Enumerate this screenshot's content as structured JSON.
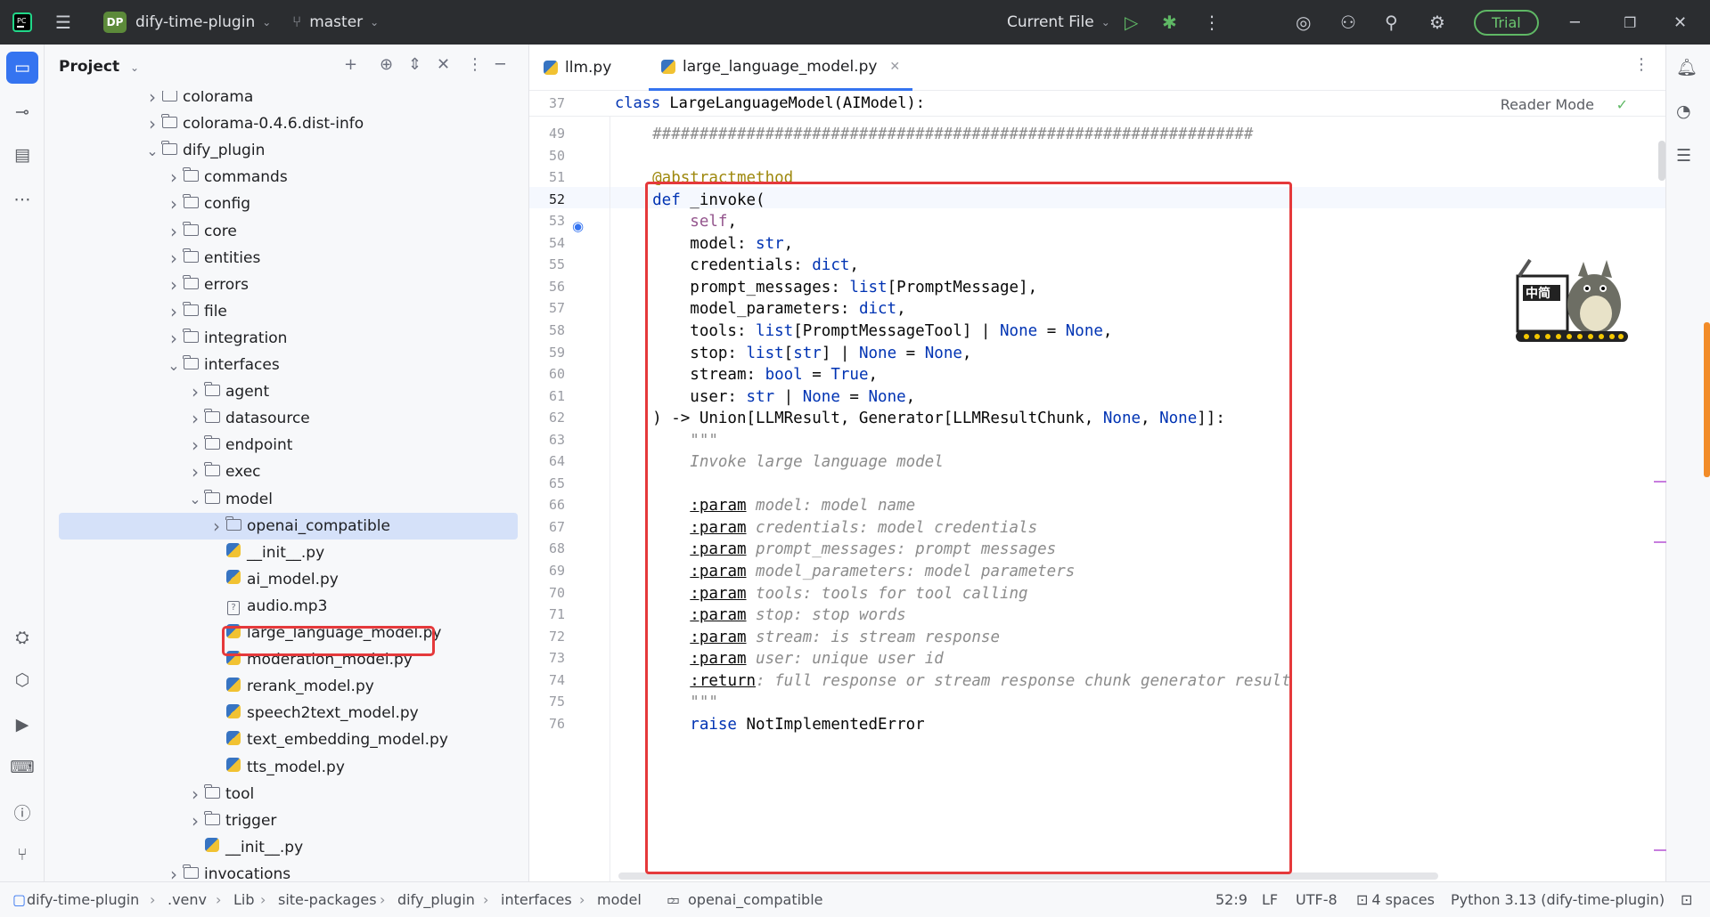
{
  "titlebar": {
    "project_badge": "DP",
    "project_name": "dify-time-plugin",
    "branch": "master",
    "run_config": "Current File",
    "trial": "Trial"
  },
  "project_panel": {
    "title": "Project"
  },
  "tree": [
    {
      "label": "colorama",
      "type": "folder",
      "depth": 0,
      "arrow": "right"
    },
    {
      "label": "colorama-0.4.6.dist-info",
      "type": "folder",
      "depth": 0,
      "arrow": "right"
    },
    {
      "label": "dify_plugin",
      "type": "folder",
      "depth": 0,
      "arrow": "down"
    },
    {
      "label": "commands",
      "type": "folder",
      "depth": 1,
      "arrow": "right"
    },
    {
      "label": "config",
      "type": "folder",
      "depth": 1,
      "arrow": "right"
    },
    {
      "label": "core",
      "type": "folder",
      "depth": 1,
      "arrow": "right"
    },
    {
      "label": "entities",
      "type": "folder",
      "depth": 1,
      "arrow": "right"
    },
    {
      "label": "errors",
      "type": "folder",
      "depth": 1,
      "arrow": "right"
    },
    {
      "label": "file",
      "type": "folder",
      "depth": 1,
      "arrow": "right"
    },
    {
      "label": "integration",
      "type": "folder",
      "depth": 1,
      "arrow": "right"
    },
    {
      "label": "interfaces",
      "type": "folder",
      "depth": 1,
      "arrow": "down"
    },
    {
      "label": "agent",
      "type": "folder",
      "depth": 2,
      "arrow": "right"
    },
    {
      "label": "datasource",
      "type": "folder",
      "depth": 2,
      "arrow": "right"
    },
    {
      "label": "endpoint",
      "type": "folder",
      "depth": 2,
      "arrow": "right"
    },
    {
      "label": "exec",
      "type": "folder",
      "depth": 2,
      "arrow": "right"
    },
    {
      "label": "model",
      "type": "folder",
      "depth": 2,
      "arrow": "down"
    },
    {
      "label": "openai_compatible",
      "type": "folder",
      "depth": 3,
      "arrow": "right",
      "selected": true
    },
    {
      "label": "__init__.py",
      "type": "py",
      "depth": 3,
      "arrow": ""
    },
    {
      "label": "ai_model.py",
      "type": "py",
      "depth": 3,
      "arrow": ""
    },
    {
      "label": "audio.mp3",
      "type": "unknown",
      "depth": 3,
      "arrow": ""
    },
    {
      "label": "large_language_model.py",
      "type": "py",
      "depth": 3,
      "arrow": ""
    },
    {
      "label": "moderation_model.py",
      "type": "py",
      "depth": 3,
      "arrow": ""
    },
    {
      "label": "rerank_model.py",
      "type": "py",
      "depth": 3,
      "arrow": ""
    },
    {
      "label": "speech2text_model.py",
      "type": "py",
      "depth": 3,
      "arrow": ""
    },
    {
      "label": "text_embedding_model.py",
      "type": "py",
      "depth": 3,
      "arrow": ""
    },
    {
      "label": "tts_model.py",
      "type": "py",
      "depth": 3,
      "arrow": ""
    },
    {
      "label": "tool",
      "type": "folder",
      "depth": 2,
      "arrow": "right"
    },
    {
      "label": "trigger",
      "type": "folder",
      "depth": 2,
      "arrow": "right"
    },
    {
      "label": "__init__.py",
      "type": "py",
      "depth": 2,
      "arrow": ""
    },
    {
      "label": "invocations",
      "type": "folder",
      "depth": 1,
      "arrow": "right"
    }
  ],
  "editor": {
    "tabs": [
      {
        "label": "llm.py",
        "active": false
      },
      {
        "label": "large_language_model.py",
        "active": true
      }
    ],
    "reader_mode": "Reader Mode",
    "sticky_line_number": "37",
    "sticky_code": [
      [
        "kw",
        "class"
      ],
      [
        "",
        " LargeLanguageModel(AIModel):"
      ]
    ],
    "lines": [
      {
        "n": "49",
        "tokens": [
          [
            "cmt",
            "    ################################################################"
          ]
        ]
      },
      {
        "n": "50",
        "tokens": []
      },
      {
        "n": "51",
        "tokens": [
          [
            "dec",
            "    @abstractmethod"
          ]
        ]
      },
      {
        "n": "52",
        "tokens": [
          [
            "kw",
            "    def"
          ],
          [
            "",
            " _invoke("
          ]
        ]
      },
      {
        "n": "53",
        "tokens": [
          [
            "sf",
            "        self"
          ],
          [
            "",
            ","
          ]
        ]
      },
      {
        "n": "54",
        "tokens": [
          [
            "",
            "        model: "
          ],
          [
            "kw",
            "str"
          ],
          [
            "",
            ","
          ]
        ]
      },
      {
        "n": "55",
        "tokens": [
          [
            "",
            "        credentials: "
          ],
          [
            "kw",
            "dict"
          ],
          [
            "",
            ","
          ]
        ]
      },
      {
        "n": "56",
        "tokens": [
          [
            "",
            "        prompt_messages: "
          ],
          [
            "kw",
            "list"
          ],
          [
            "",
            "[PromptMessage],"
          ]
        ]
      },
      {
        "n": "57",
        "tokens": [
          [
            "",
            "        model_parameters: "
          ],
          [
            "kw",
            "dict"
          ],
          [
            "",
            ","
          ]
        ]
      },
      {
        "n": "58",
        "tokens": [
          [
            "",
            "        tools: "
          ],
          [
            "kw",
            "list"
          ],
          [
            "",
            "[PromptMessageTool] | "
          ],
          [
            "kw",
            "None"
          ],
          [
            "",
            " = "
          ],
          [
            "kw",
            "None"
          ],
          [
            "",
            ","
          ]
        ]
      },
      {
        "n": "59",
        "tokens": [
          [
            "",
            "        stop: "
          ],
          [
            "kw",
            "list"
          ],
          [
            "",
            "["
          ],
          [
            "kw",
            "str"
          ],
          [
            "",
            "] | "
          ],
          [
            "kw",
            "None"
          ],
          [
            "",
            " = "
          ],
          [
            "kw",
            "None"
          ],
          [
            "",
            ","
          ]
        ]
      },
      {
        "n": "60",
        "tokens": [
          [
            "",
            "        stream: "
          ],
          [
            "kw",
            "bool"
          ],
          [
            "",
            " = "
          ],
          [
            "kw",
            "True"
          ],
          [
            "",
            ","
          ]
        ]
      },
      {
        "n": "61",
        "tokens": [
          [
            "",
            "        user: "
          ],
          [
            "kw",
            "str"
          ],
          [
            "",
            " | "
          ],
          [
            "kw",
            "None"
          ],
          [
            "",
            " = "
          ],
          [
            "kw",
            "None"
          ],
          [
            "",
            ","
          ]
        ]
      },
      {
        "n": "62",
        "tokens": [
          [
            "",
            "    ) -> Union[LLMResult, Generator[LLMResultChunk, "
          ],
          [
            "kw",
            "None"
          ],
          [
            "",
            ", "
          ],
          [
            "kw",
            "None"
          ],
          [
            "",
            "]]:"
          ]
        ]
      },
      {
        "n": "63",
        "tokens": [
          [
            "doc",
            "        \"\"\""
          ]
        ]
      },
      {
        "n": "64",
        "tokens": [
          [
            "doc",
            "        Invoke large language model"
          ]
        ]
      },
      {
        "n": "65",
        "tokens": []
      },
      {
        "n": "66",
        "tokens": [
          [
            "doc",
            "        "
          ],
          [
            "tag",
            ":param"
          ],
          [
            "doc",
            " model: model name"
          ]
        ]
      },
      {
        "n": "67",
        "tokens": [
          [
            "doc",
            "        "
          ],
          [
            "tag",
            ":param"
          ],
          [
            "doc",
            " credentials: model credentials"
          ]
        ]
      },
      {
        "n": "68",
        "tokens": [
          [
            "doc",
            "        "
          ],
          [
            "tag",
            ":param"
          ],
          [
            "doc",
            " prompt_messages: prompt messages"
          ]
        ]
      },
      {
        "n": "69",
        "tokens": [
          [
            "doc",
            "        "
          ],
          [
            "tag",
            ":param"
          ],
          [
            "doc",
            " model_parameters: model parameters"
          ]
        ]
      },
      {
        "n": "70",
        "tokens": [
          [
            "doc",
            "        "
          ],
          [
            "tag",
            ":param"
          ],
          [
            "doc",
            " tools: tools for tool calling"
          ]
        ]
      },
      {
        "n": "71",
        "tokens": [
          [
            "doc",
            "        "
          ],
          [
            "tag",
            ":param"
          ],
          [
            "doc",
            " stop: stop words"
          ]
        ]
      },
      {
        "n": "72",
        "tokens": [
          [
            "doc",
            "        "
          ],
          [
            "tag",
            ":param"
          ],
          [
            "doc",
            " stream: is stream response"
          ]
        ]
      },
      {
        "n": "73",
        "tokens": [
          [
            "doc",
            "        "
          ],
          [
            "tag",
            ":param"
          ],
          [
            "doc",
            " user: unique user id"
          ]
        ]
      },
      {
        "n": "74",
        "tokens": [
          [
            "doc",
            "        "
          ],
          [
            "tag",
            ":return"
          ],
          [
            "doc",
            ": full response or stream response chunk generator result"
          ]
        ]
      },
      {
        "n": "75",
        "tokens": [
          [
            "doc",
            "        \"\"\""
          ]
        ]
      },
      {
        "n": "76",
        "tokens": [
          [
            "kw",
            "        raise"
          ],
          [
            "",
            " NotImplementedError"
          ]
        ]
      }
    ]
  },
  "statusbar": {
    "crumbs": [
      "dify-time-plugin",
      ".venv",
      "Lib",
      "site-packages",
      "dify_plugin",
      "interfaces",
      "model",
      "openai_compatible"
    ],
    "position": "52:9",
    "line_ending": "LF",
    "encoding": "UTF-8",
    "indent": "4 spaces",
    "interpreter": "Python 3.13 (dify-time-plugin)"
  },
  "colors": {
    "accent": "#3574f0",
    "highlight_red": "#e5393b",
    "keyword": "#0033b3",
    "decorator": "#9e880d"
  }
}
